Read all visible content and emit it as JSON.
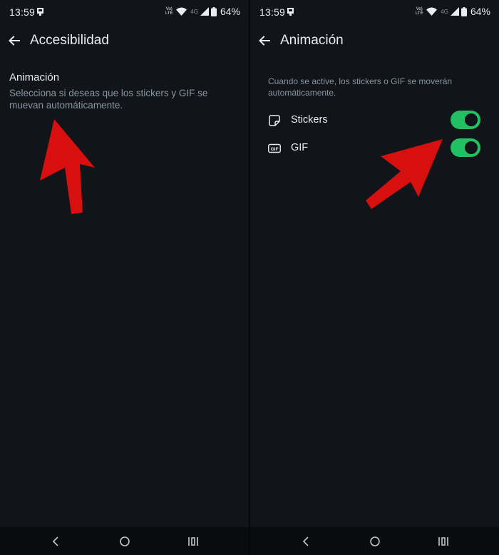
{
  "status_bar": {
    "time": "13:59",
    "volte": "Vo) LTE",
    "network": "4G",
    "battery": "64%"
  },
  "left_screen": {
    "title": "Accesibilidad",
    "section_title": "Animación",
    "section_description": "Selecciona si deseas que los stickers y GIF se muevan automáticamente."
  },
  "right_screen": {
    "title": "Animación",
    "description": "Cuando se active, los stickers o GIF se moverán automáticamente.",
    "options": [
      {
        "icon": "sticker-icon",
        "label": "Stickers",
        "enabled": true
      },
      {
        "icon": "gif-icon",
        "label": "GIF",
        "enabled": true
      }
    ]
  },
  "colors": {
    "background": "#111418",
    "toggle_on": "#21c063",
    "annotation_arrow": "#d80f0f",
    "text_primary": "#e9edef",
    "text_secondary": "#8696a0"
  }
}
